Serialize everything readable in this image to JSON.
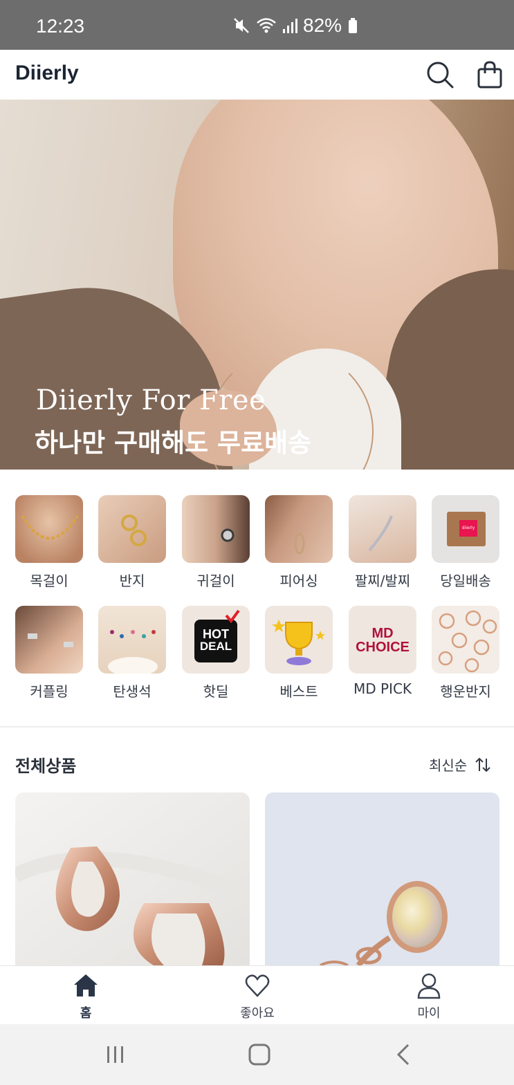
{
  "status_bar": {
    "time": "12:23",
    "battery": "82%"
  },
  "app_bar": {
    "brand": "Diierly"
  },
  "hero": {
    "title_en": "Diierly For Free",
    "title_ko": "하나만 구매해도 무료배송"
  },
  "categories": [
    {
      "label": "목걸이"
    },
    {
      "label": "반지"
    },
    {
      "label": "귀걸이"
    },
    {
      "label": "피어싱"
    },
    {
      "label": "팔찌/발찌"
    },
    {
      "label": "당일배송",
      "box_text": "diierly"
    },
    {
      "label": "커플링"
    },
    {
      "label": "탄생석"
    },
    {
      "label": "핫딜",
      "badge_line1": "HOT",
      "badge_line2": "DEAL"
    },
    {
      "label": "베스트"
    },
    {
      "label": "MD PICK",
      "badge_line1": "MD",
      "badge_line2": "CHOICE"
    },
    {
      "label": "행운반지"
    }
  ],
  "section": {
    "title": "전체상품",
    "sort_label": "최신순"
  },
  "bottom_nav": {
    "home": "홈",
    "likes": "좋아요",
    "my": "마이"
  },
  "colors": {
    "brand_text": "#1c2533",
    "hot_deal_bg": "#111111",
    "hot_deal_check": "#e0202a",
    "md_choice_text": "#b0123a",
    "box_label": "#e8154f"
  }
}
